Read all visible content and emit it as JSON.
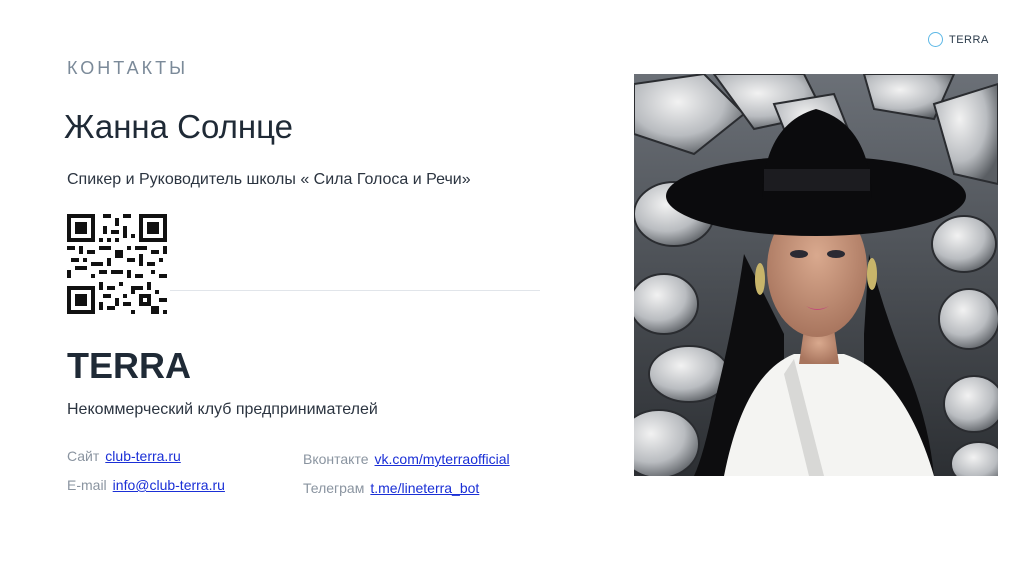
{
  "logo": {
    "text": "TERRA",
    "icon": "circle-logo-icon",
    "accent": "#5db8e6"
  },
  "section_title": "КОНТАКТЫ",
  "person": {
    "name": "Жанна Солнце",
    "role": "Спикер и Руководитель школы « Сила Голоса и Речи»"
  },
  "qr": {
    "icon": "qr-code-icon"
  },
  "org": {
    "name": "TERRA",
    "tagline": "Некоммерческий клуб предпринимателей"
  },
  "contacts": {
    "site": {
      "label": "Сайт",
      "link": "club-terra.ru"
    },
    "email": {
      "label": "E-mail",
      "link": "info@club-terra.ru"
    },
    "vk": {
      "label": "Вконтакте",
      "link": "vk.com/myterraofficial"
    },
    "telegram": {
      "label": "Телеграм",
      "link": "t.me/lineterra_bot"
    }
  },
  "colors": {
    "link": "#1a2fd6",
    "muted": "#7b8a99",
    "text": "#1f2a36"
  }
}
